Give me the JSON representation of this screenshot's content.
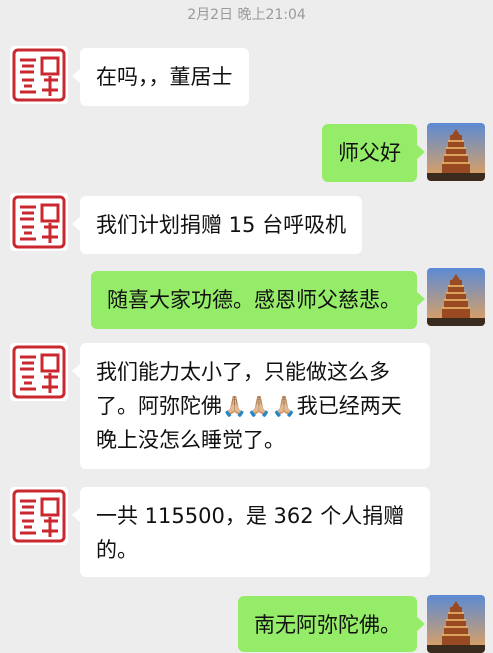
{
  "timestamp": "2月2日 晚上21:04",
  "icons": {
    "incoming_avatar": "red-seal-avatar",
    "outgoing_avatar": "pagoda-avatar",
    "emoji": "folded-hands"
  },
  "colors": {
    "background": "#ededed",
    "incoming_bubble": "#ffffff",
    "outgoing_bubble": "#95ec69"
  },
  "messages": [
    {
      "side": "in",
      "text": "在吗，，董居士"
    },
    {
      "side": "out",
      "text": "师父好"
    },
    {
      "side": "in",
      "text": "我们计划捐赠 15 台呼吸机"
    },
    {
      "side": "out",
      "text": "随喜大家功德。感恩师父慈悲。"
    },
    {
      "side": "in",
      "text_before": "我们能力太小了，只能做这么多了。阿弥陀佛",
      "emoji": "🙏🏼🙏🏼🙏🏼",
      "text_after": "我已经两天晚上没怎么睡觉了。"
    },
    {
      "side": "in",
      "text": "一共 115500，是 362 个人捐赠的。"
    },
    {
      "side": "out",
      "text": "南无阿弥陀佛。"
    }
  ]
}
